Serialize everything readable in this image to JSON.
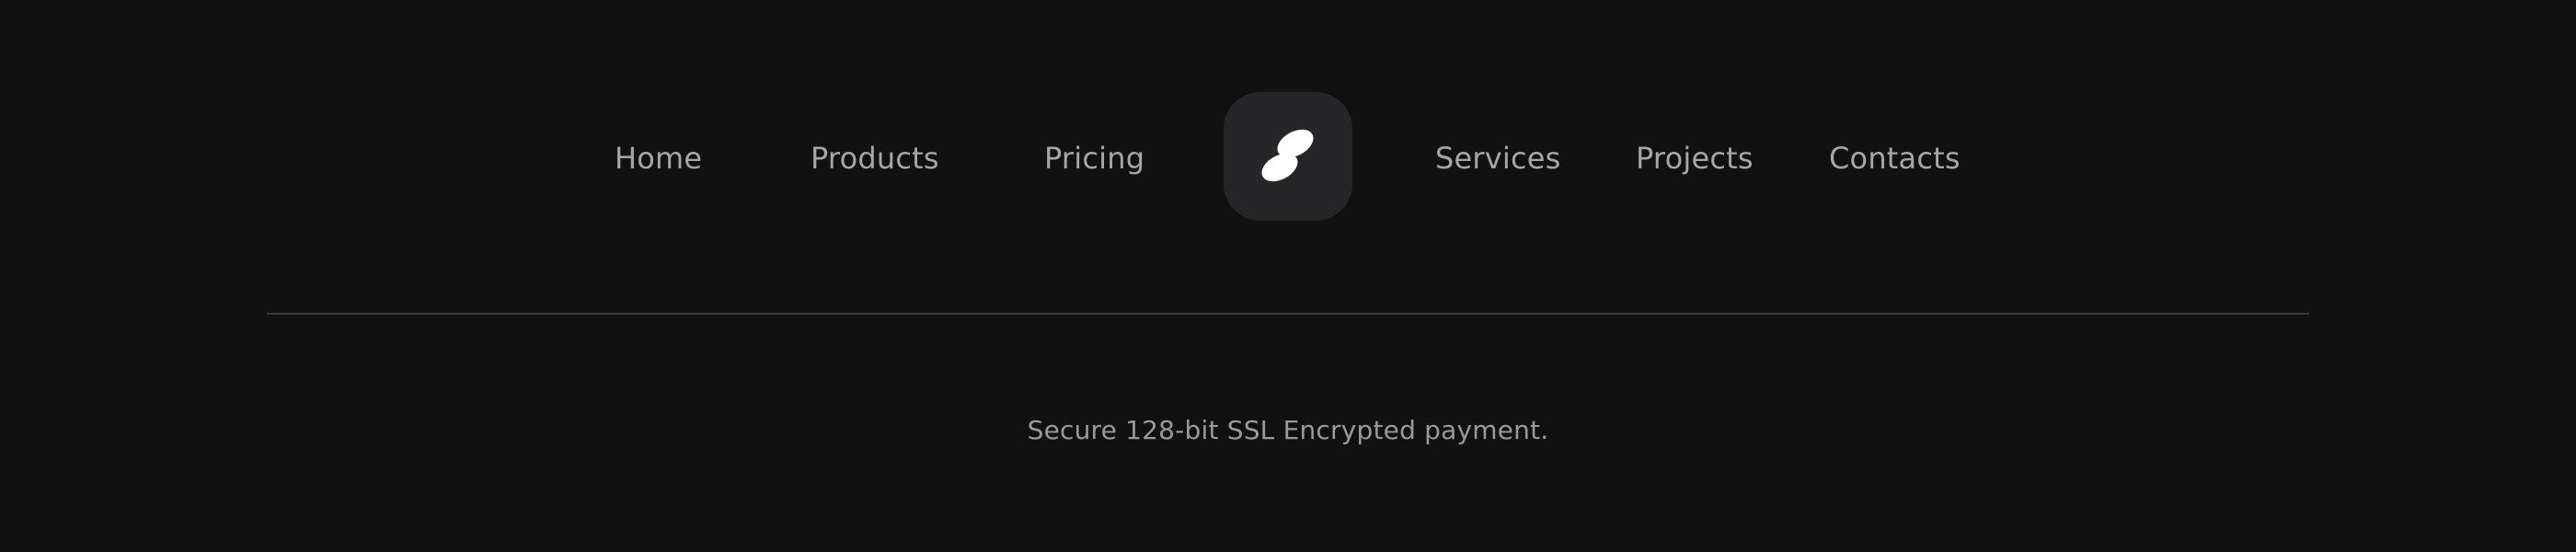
{
  "nav": {
    "left_items": [
      {
        "label": "Home"
      },
      {
        "label": "Products"
      },
      {
        "label": "Pricing"
      }
    ],
    "right_items": [
      {
        "label": "Services"
      },
      {
        "label": "Projects"
      },
      {
        "label": "Contacts"
      }
    ],
    "logo": {
      "icon": "two-pebble-logo-icon",
      "tile_color": "#262628",
      "mark_color": "#ffffff"
    }
  },
  "footer": {
    "security_note": "Secure 128-bit SSL Encrypted payment."
  },
  "colors": {
    "background": "#111111",
    "link_text": "#a6a6a6",
    "divider": "#3b3b3b"
  }
}
